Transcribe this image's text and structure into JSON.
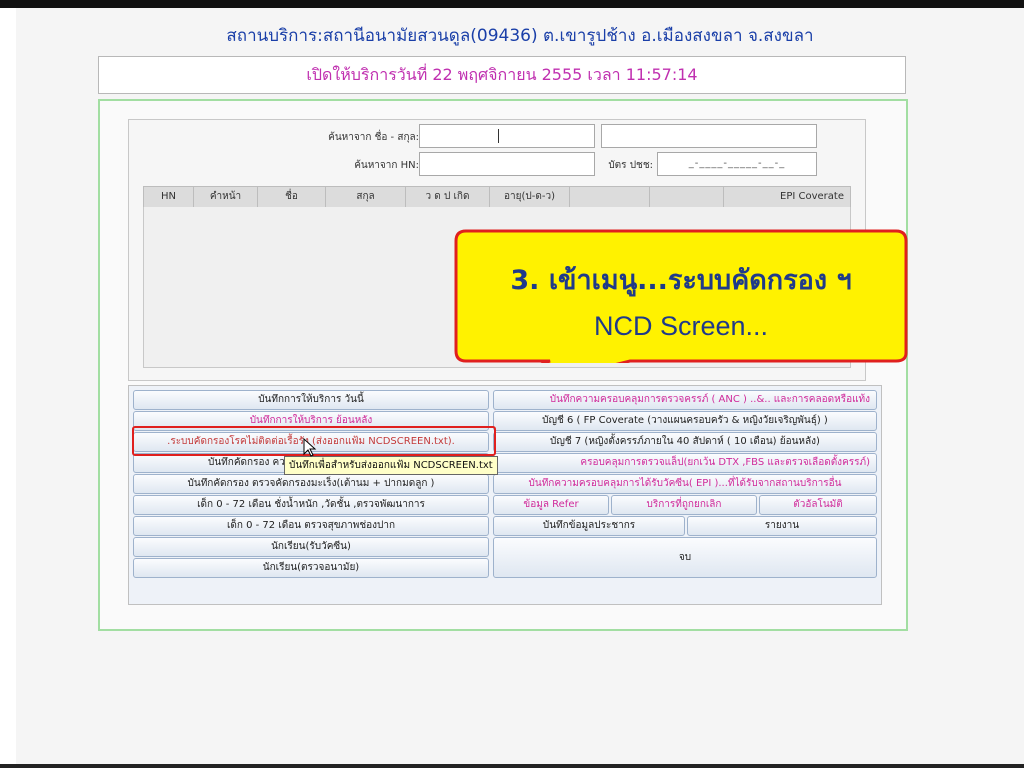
{
  "header": {
    "clinic": "สถานบริการ:สถานีอนามัยสวนดูล(09436) ต.เขารูปช้าง อ.เมืองสงขลา จ.สงขลา",
    "service_open": "เปิดให้บริการวันที่ 22 พฤศจิกายน 2555 เวลา 11:57:14"
  },
  "search": {
    "name_label": "ค้นหาจาก ชื่อ - สกุล:",
    "hn_label": "ค้นหาจาก HN:",
    "id_label": "บัตร ปชช:",
    "id_value": "_-____-_____-__-_"
  },
  "table": {
    "columns": [
      "HN",
      "คำหน้า",
      "ชื่อ",
      "สกุล",
      "ว ด ป เกิด",
      "อายุ(ป-ด-ว)",
      "",
      "",
      "EPI Coverate"
    ]
  },
  "menu": {
    "left": [
      "บันทึกการให้บริการ วันนี้",
      "บันทึกการให้บริการ ย้อนหลัง",
      ".ระบบคัดกรองโรคไม่ติดต่อเรื้อรัง (ส่งออกแฟ้ม NCDSCREEN.txt).",
      "บันทึกคัดกรอง ความดั",
      "บันทึกคัดกรอง ตรวจคัดกรองมะเร็ง(เต้านม + ปากมดลูก )",
      "เด็ก 0 - 72 เดือน ชั่งน้ำหนัก ,วัดชั้น ,ตรวจพัฒนาการ",
      "เด็ก 0 - 72 เดือน ตรวจสุขภาพช่องปาก",
      "นักเรียน(รับวัคซีน)",
      "นักเรียน(ตรวจอนามัย)"
    ],
    "right": [
      "บันทึกความครอบคลุมการตรวจครรภ์ ( ANC ) ..&.. และการคลอดหรือแท้ง",
      "บัญชี 6 ( FP Coverate (วางแผนครอบครัว & หญิงวัยเจริญพันธุ์) )",
      "บัญชี 7 (หญิงตั้งครรภ์ภายใน 40 สัปดาห์ ( 10 เดือน) ย้อนหลัง)",
      "ครอบคลุมการตรวจแล็ป(ยกเว้น DTX ,FBS และตรวจเลือดตั้งครรภ์)",
      "บันทึกความครอบคลุมการได้รับวัคซีน( EPI )...ที่ได้รับจากสถานบริการอื่น"
    ],
    "refer": "ข้อมูล Refer",
    "abused": "บริการที่ถูกยกเลิก",
    "tail": "ตัวอัลโนมัติ",
    "population": "บันทึกข้อมูลประชากร",
    "report": "รายงาน",
    "exit": "จบ"
  },
  "tooltip": "บันทึกเพื่อสำหรับส่งออกแฟ้ม NCDSCREEN.txt",
  "callout": {
    "line1": "3. เข้าเมนู...ระบบคัดกรอง ฯ",
    "line2": "NCD Screen..."
  },
  "colors": {
    "title_blue": "#1a3fa8",
    "pink": "#d02a9a",
    "callout_fill": "#fff200",
    "callout_border": "#e0201e",
    "callout_text": "#1f3a8a",
    "green_border": "#a2dea2"
  }
}
